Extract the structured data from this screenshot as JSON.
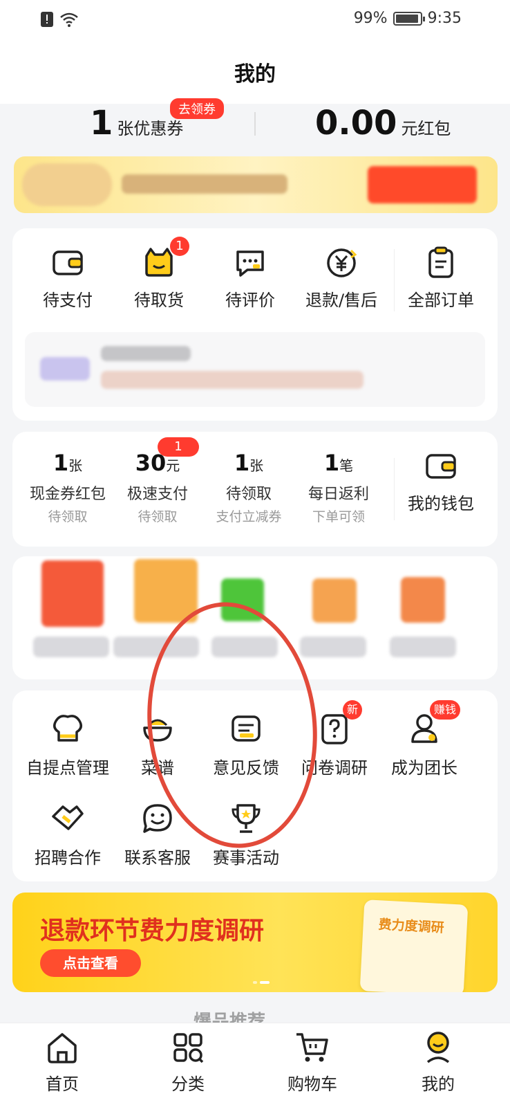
{
  "status_bar": {
    "battery": "99%",
    "time": "9:35"
  },
  "header": {
    "title": "我的"
  },
  "coupon": {
    "count": "1",
    "unit": "张优惠券",
    "tag": "去领券",
    "redpacket_amount": "0.00",
    "redpacket_unit": "元红包"
  },
  "orders": {
    "items": [
      {
        "label": "待支付",
        "icon": "wallet-icon"
      },
      {
        "label": "待取货",
        "icon": "cat-bag-icon",
        "badge": "1"
      },
      {
        "label": "待评价",
        "icon": "chat-bubble-icon"
      },
      {
        "label": "退款/售后",
        "icon": "yen-refund-icon"
      },
      {
        "label": "全部订单",
        "icon": "clipboard-icon"
      }
    ]
  },
  "wallet": {
    "items": [
      {
        "value": "1",
        "unit": "张",
        "label": "现金券红包",
        "sub": "待领取"
      },
      {
        "value": "30",
        "unit": "元",
        "label": "极速支付",
        "sub": "待领取",
        "badge": "1"
      },
      {
        "value": "1",
        "unit": "张",
        "label": "待领取",
        "sub": "支付立减券"
      },
      {
        "value": "1",
        "unit": "笔",
        "label": "每日返利",
        "sub": "下单可领"
      }
    ],
    "my_wallet_label": "我的钱包"
  },
  "tools": {
    "items": [
      {
        "label": "自提点管理",
        "icon": "chef-hat-icon"
      },
      {
        "label": "菜谱",
        "icon": "bowl-icon"
      },
      {
        "label": "意见反馈",
        "icon": "feedback-icon"
      },
      {
        "label": "问卷调研",
        "icon": "question-icon",
        "badge": "新"
      },
      {
        "label": "成为团长",
        "icon": "user-icon",
        "badge": "赚钱"
      },
      {
        "label": "招聘合作",
        "icon": "handshake-icon"
      },
      {
        "label": "联系客服",
        "icon": "smile-chat-icon"
      },
      {
        "label": "赛事活动",
        "icon": "trophy-icon"
      }
    ]
  },
  "banner": {
    "title": "退款环节费力度调研",
    "button": "点击查看",
    "paper_text": "费力度调研"
  },
  "rec_peek": "爆品推荐",
  "tab_bar": {
    "tabs": [
      {
        "label": "首页",
        "icon": "home-icon"
      },
      {
        "label": "分类",
        "icon": "category-icon"
      },
      {
        "label": "购物车",
        "icon": "cart-icon"
      },
      {
        "label": "我的",
        "icon": "profile-icon"
      }
    ]
  },
  "colors": {
    "accent": "#ff3b2f",
    "brand_yellow": "#ffd21a",
    "annotation": "#e24a3a"
  }
}
